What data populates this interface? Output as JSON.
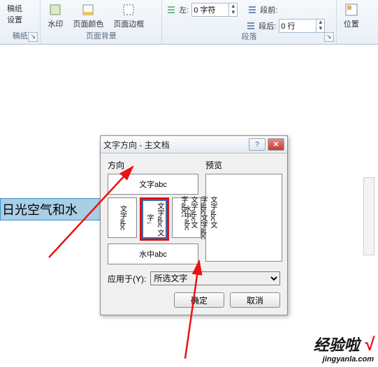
{
  "ribbon": {
    "group1": {
      "btn1_line1": "稿纸",
      "btn1_line2": "设置",
      "label": "稿纸"
    },
    "group2": {
      "btn1": "水印",
      "btn2": "页面颜色",
      "btn3": "页面边框",
      "label": "页面背景"
    },
    "group3": {
      "left_label": "左:",
      "left_value": "0 字符",
      "before_label": "段前:",
      "after_label": "段后:",
      "after_value": "0 行",
      "label": "段落"
    },
    "group4": {
      "btn1": "位置"
    }
  },
  "document": {
    "text": "日光空气和水"
  },
  "dialog": {
    "title": "文字方向 - 主文档",
    "section_orient": "方向",
    "section_preview": "预览",
    "opt_horiz": "文字abc",
    "opt_vert1": "文字abc",
    "opt_sel_line1": "文字abc",
    "opt_sel_line2": "文字↓",
    "opt_vert2": "水中abc",
    "opt_bottom": "水中abc",
    "preview_lines": {
      "c1": "字abc↓",
      "c2": "文字abc文",
      "c3": "字abc文字abc",
      "c4": "文字abc文"
    },
    "apply_label": "应用于(Y):",
    "apply_value": "所选文字",
    "ok": "确定",
    "cancel": "取消"
  },
  "watermark": {
    "line1": "经验啦",
    "check": "√",
    "line2": "jingyanla.com"
  }
}
